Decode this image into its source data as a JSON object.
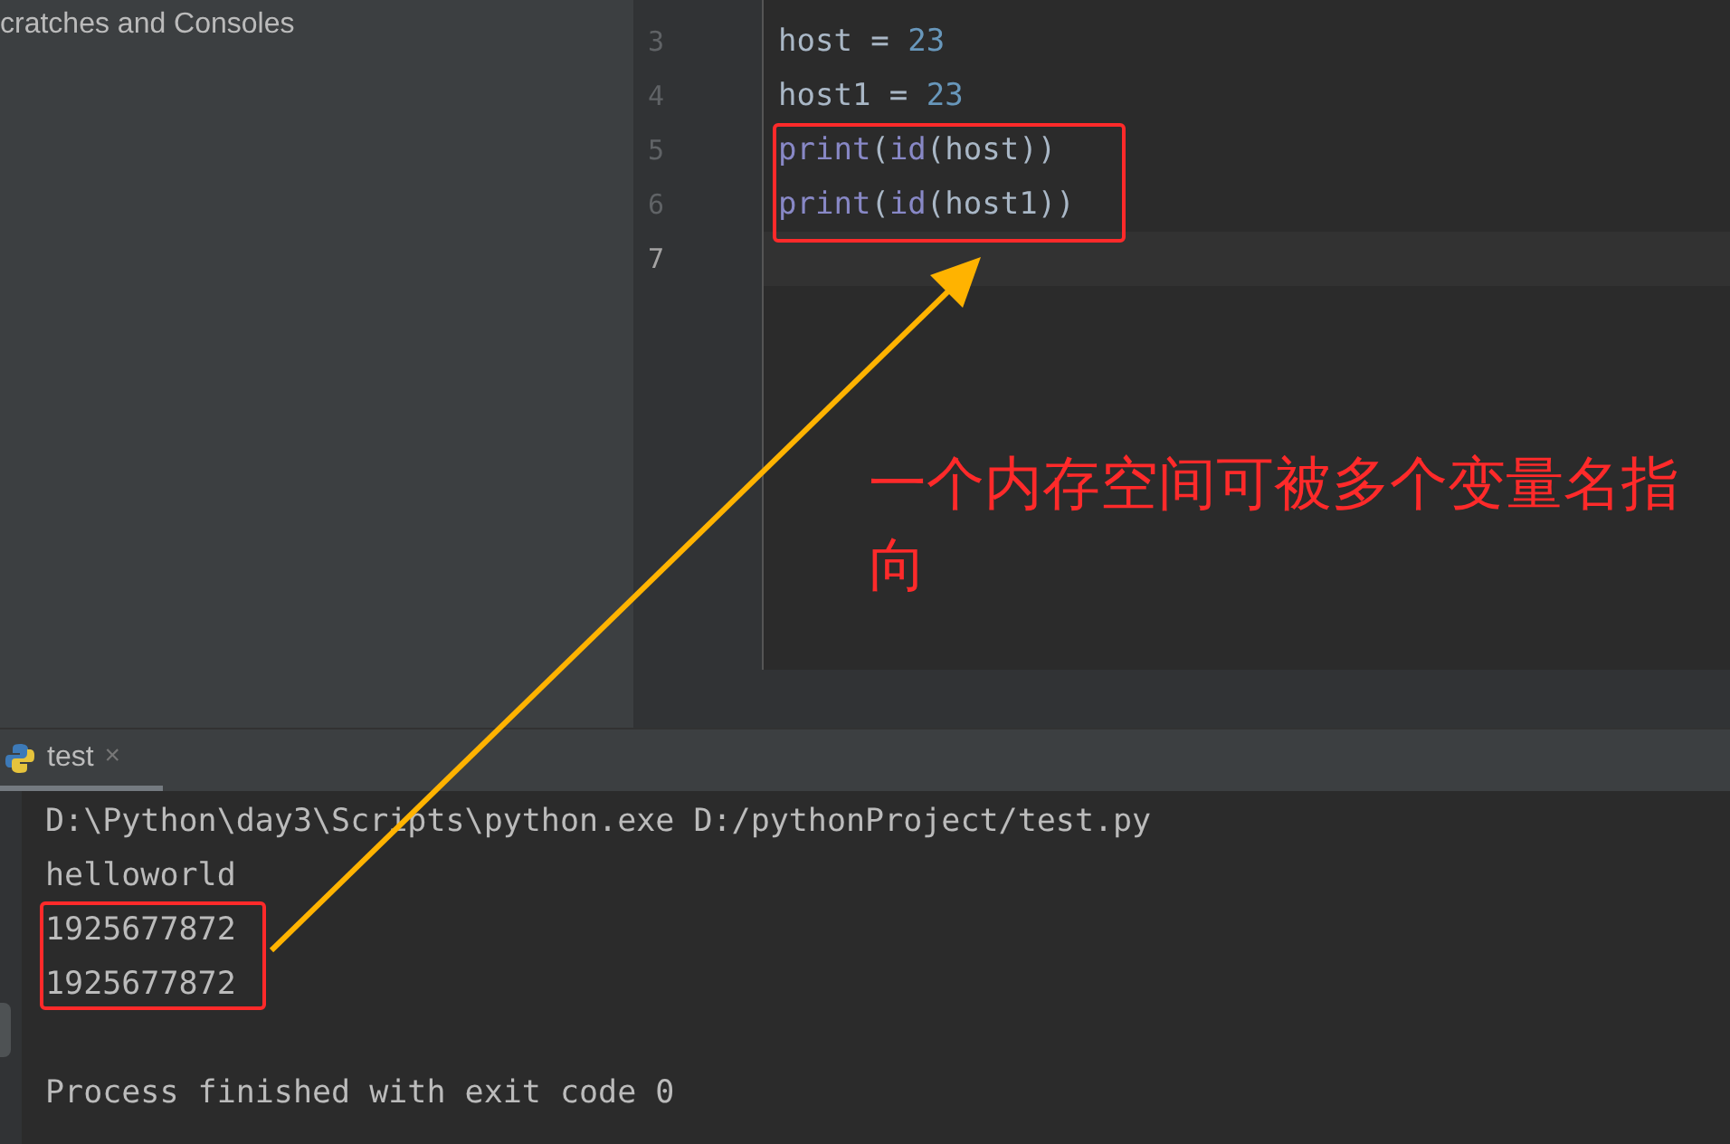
{
  "sidebar": {
    "title": "cratches and Consoles"
  },
  "editor": {
    "lines": [
      {
        "number": "3",
        "current": false,
        "parts": [
          {
            "text": "host = ",
            "kind": "plain"
          },
          {
            "text": "23",
            "kind": "number"
          }
        ]
      },
      {
        "number": "4",
        "current": false,
        "parts": [
          {
            "text": "host1 = ",
            "kind": "plain"
          },
          {
            "text": "23",
            "kind": "number"
          }
        ]
      },
      {
        "number": "5",
        "current": false,
        "parts": [
          {
            "text": "print",
            "kind": "builtin"
          },
          {
            "text": "(",
            "kind": "plain"
          },
          {
            "text": "id",
            "kind": "builtin"
          },
          {
            "text": "(host))",
            "kind": "plain"
          }
        ]
      },
      {
        "number": "6",
        "current": false,
        "parts": [
          {
            "text": "print",
            "kind": "builtin"
          },
          {
            "text": "(",
            "kind": "plain"
          },
          {
            "text": "id",
            "kind": "builtin"
          },
          {
            "text": "(host1))",
            "kind": "plain"
          }
        ]
      },
      {
        "number": "7",
        "current": true
      }
    ]
  },
  "run_panel": {
    "tabs": [
      {
        "label": "test",
        "selected": true,
        "close": "×"
      }
    ],
    "console_lines": [
      "D:\\Python\\day3\\Scripts\\python.exe D:/pythonProject/test.py",
      "helloworld",
      "1925677872",
      "1925677872"
    ],
    "exit_message": "Process finished with exit code 0"
  },
  "annotation": {
    "note": "一个内存空间可被多个变量名指向"
  }
}
